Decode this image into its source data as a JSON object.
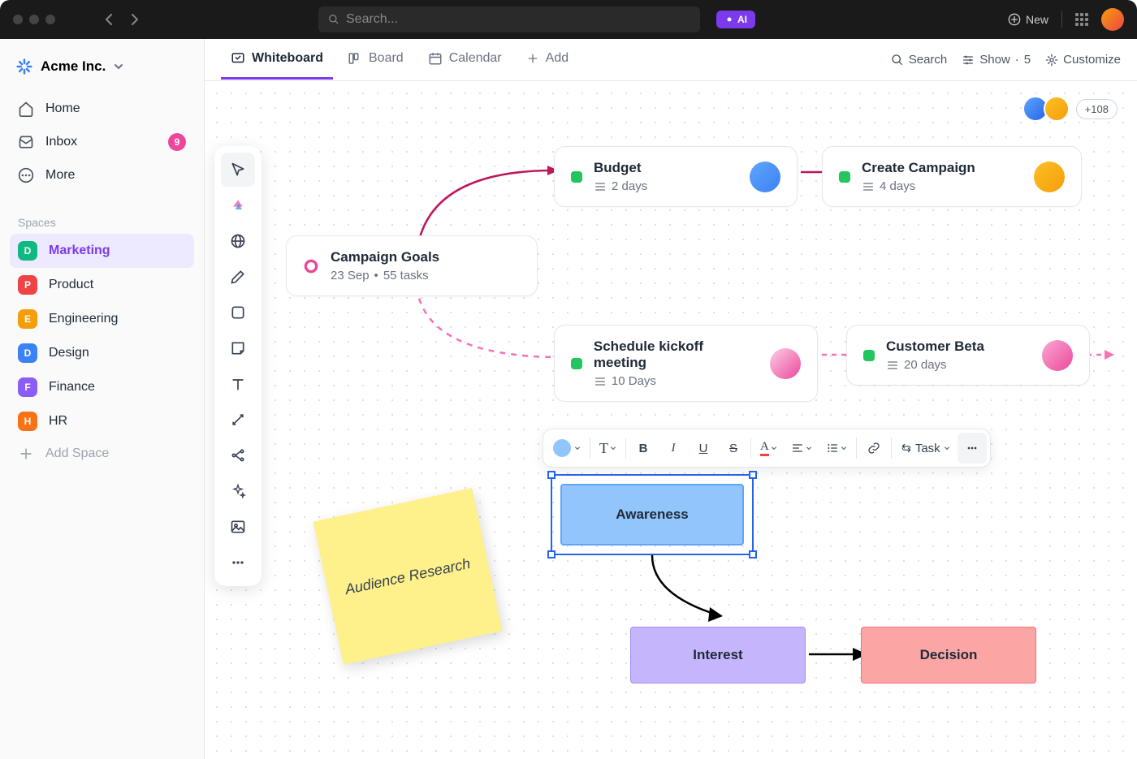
{
  "titlebar": {
    "search_placeholder": "Search...",
    "ai_label": "AI",
    "new_label": "New"
  },
  "sidebar": {
    "workspace_name": "Acme Inc.",
    "nav": {
      "home": "Home",
      "inbox": "Inbox",
      "inbox_badge": "9",
      "more": "More"
    },
    "spaces_label": "Spaces",
    "spaces": [
      {
        "initial": "D",
        "color": "#10b981",
        "label": "Marketing"
      },
      {
        "initial": "P",
        "color": "#ef4444",
        "label": "Product"
      },
      {
        "initial": "E",
        "color": "#f59e0b",
        "label": "Engineering"
      },
      {
        "initial": "D",
        "color": "#3b82f6",
        "label": "Design"
      },
      {
        "initial": "F",
        "color": "#8b5cf6",
        "label": "Finance"
      },
      {
        "initial": "H",
        "color": "#f97316",
        "label": "HR"
      }
    ],
    "add_space_label": "Add Space"
  },
  "views": {
    "whiteboard": "Whiteboard",
    "board": "Board",
    "calendar": "Calendar",
    "add": "Add"
  },
  "toolbar_right": {
    "search": "Search",
    "show": "Show",
    "show_count": "5",
    "customize": "Customize"
  },
  "collab": {
    "extra_count": "+108"
  },
  "cards": {
    "goals": {
      "title": "Campaign Goals",
      "date": "23 Sep",
      "tasks": "55 tasks"
    },
    "budget": {
      "title": "Budget",
      "duration": "2 days"
    },
    "create_campaign": {
      "title": "Create Campaign",
      "duration": "4 days"
    },
    "kickoff": {
      "title": "Schedule kickoff meeting",
      "duration": "10 Days"
    },
    "beta": {
      "title": "Customer Beta",
      "duration": "20 days"
    }
  },
  "sticky": {
    "text": "Audience Research"
  },
  "flow": {
    "awareness": "Awareness",
    "interest": "Interest",
    "decision": "Decision"
  },
  "text_toolbar": {
    "task": "Task"
  }
}
